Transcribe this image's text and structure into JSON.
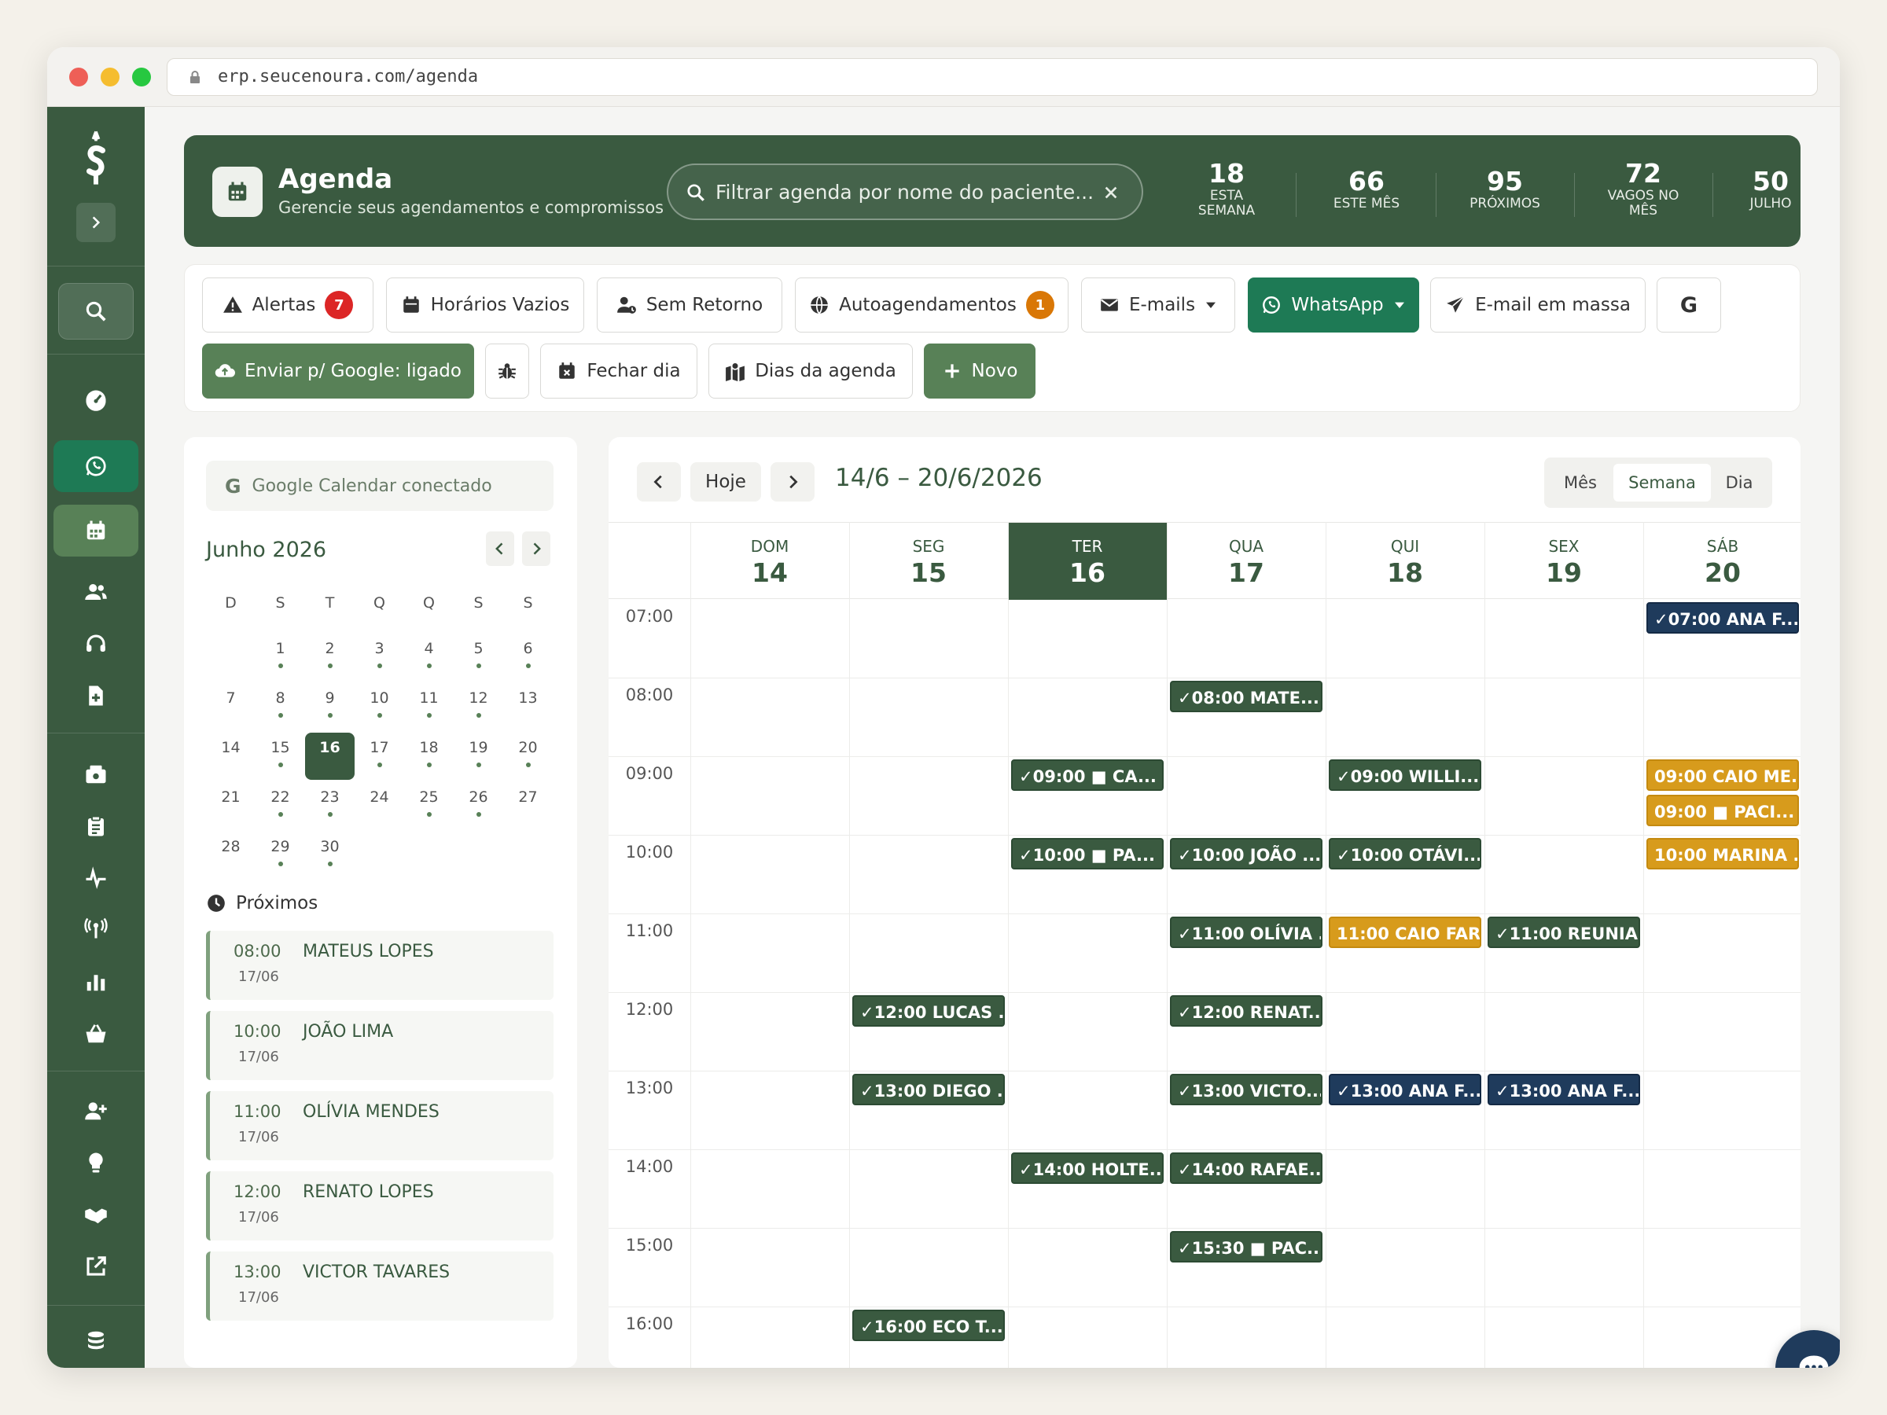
{
  "browser": {
    "url": "erp.seucenoura.com/agenda"
  },
  "colors": {
    "primary": "#3a5a40",
    "accent": "#588157",
    "navy": "#1f3b5c",
    "gold": "#d79b1c",
    "danger": "#dc2626",
    "warning": "#d97706"
  },
  "header": {
    "title": "Agenda",
    "subtitle": "Gerencie seus agendamentos e compromissos",
    "search_placeholder": "Filtrar agenda por nome do paciente...",
    "stats": [
      {
        "value": "18",
        "label1": "ESTA",
        "label2": "SEMANA"
      },
      {
        "value": "66",
        "label1": "ESTE MÊS",
        "label2": ""
      },
      {
        "value": "95",
        "label1": "PRÓXIMOS",
        "label2": ""
      },
      {
        "value": "72",
        "label1": "VAGOS NO",
        "label2": "MÊS"
      },
      {
        "value": "50",
        "label1": "JULHO",
        "label2": ""
      }
    ]
  },
  "toolbar": {
    "alertas": "Alertas",
    "alertas_count": "7",
    "horarios": "Horários Vazios",
    "sem_retorno": "Sem Retorno",
    "autoag": "Autoagendamentos",
    "autoag_count": "1",
    "emails": "E-mails",
    "whatsapp": "WhatsApp",
    "email_massa": "E-mail em massa",
    "google_letter": "G",
    "enviar_google": "Enviar p/ Google: ligado",
    "fechar_dia": "Fechar dia",
    "dias_agenda": "Dias da agenda",
    "novo": "Novo"
  },
  "mini_calendar": {
    "gcal_status": "Google Calendar conectado",
    "month_title": "Junho 2026",
    "weekdays": [
      "D",
      "S",
      "T",
      "Q",
      "Q",
      "S",
      "S"
    ],
    "weeks": [
      [
        {
          "d": "",
          "m": false
        },
        {
          "d": "1",
          "m": true
        },
        {
          "d": "2",
          "m": true
        },
        {
          "d": "3",
          "m": true
        },
        {
          "d": "4",
          "m": true
        },
        {
          "d": "5",
          "m": true
        },
        {
          "d": "6",
          "m": true
        }
      ],
      [
        {
          "d": "7",
          "m": false
        },
        {
          "d": "8",
          "m": true
        },
        {
          "d": "9",
          "m": true
        },
        {
          "d": "10",
          "m": true
        },
        {
          "d": "11",
          "m": true
        },
        {
          "d": "12",
          "m": true
        },
        {
          "d": "13",
          "m": false
        }
      ],
      [
        {
          "d": "14",
          "m": false
        },
        {
          "d": "15",
          "m": true
        },
        {
          "d": "16",
          "m": false,
          "today": true
        },
        {
          "d": "17",
          "m": true
        },
        {
          "d": "18",
          "m": true
        },
        {
          "d": "19",
          "m": true
        },
        {
          "d": "20",
          "m": true
        }
      ],
      [
        {
          "d": "21",
          "m": false
        },
        {
          "d": "22",
          "m": true
        },
        {
          "d": "23",
          "m": true
        },
        {
          "d": "24",
          "m": false
        },
        {
          "d": "25",
          "m": true
        },
        {
          "d": "26",
          "m": true
        },
        {
          "d": "27",
          "m": false
        }
      ],
      [
        {
          "d": "28",
          "m": false
        },
        {
          "d": "29",
          "m": true
        },
        {
          "d": "30",
          "m": true
        }
      ]
    ]
  },
  "proximos": {
    "title": "Próximos",
    "items": [
      {
        "time": "08:00",
        "date": "17/06",
        "name": "MATEUS LOPES"
      },
      {
        "time": "10:00",
        "date": "17/06",
        "name": "JOÃO LIMA"
      },
      {
        "time": "11:00",
        "date": "17/06",
        "name": "OLÍVIA MENDES"
      },
      {
        "time": "12:00",
        "date": "17/06",
        "name": "RENATO LOPES"
      },
      {
        "time": "13:00",
        "date": "17/06",
        "name": "VICTOR TAVARES"
      }
    ]
  },
  "calendar": {
    "today_label": "Hoje",
    "range": "14/6 – 20/6/2026",
    "views": [
      "Mês",
      "Semana",
      "Dia"
    ],
    "active_view": "Semana",
    "days": [
      {
        "name": "DOM",
        "num": "14"
      },
      {
        "name": "SEG",
        "num": "15"
      },
      {
        "name": "TER",
        "num": "16",
        "today": true
      },
      {
        "name": "QUA",
        "num": "17"
      },
      {
        "name": "QUI",
        "num": "18"
      },
      {
        "name": "SEX",
        "num": "19"
      },
      {
        "name": "SÁB",
        "num": "20"
      }
    ],
    "hours": [
      "07:00",
      "08:00",
      "09:00",
      "10:00",
      "11:00",
      "12:00",
      "13:00",
      "14:00",
      "15:00",
      "16:00"
    ],
    "events": [
      {
        "day": 6,
        "slot": 0,
        "sub": 0,
        "color": "navy",
        "label": "✓07:00 ANA F..."
      },
      {
        "day": 3,
        "slot": 1,
        "sub": 0,
        "color": "green",
        "label": "✓08:00 MATE..."
      },
      {
        "day": 2,
        "slot": 2,
        "sub": 0,
        "color": "green",
        "label": "✓09:00 ■ CA..."
      },
      {
        "day": 4,
        "slot": 2,
        "sub": 0,
        "color": "green",
        "label": "✓09:00 WILLI..."
      },
      {
        "day": 6,
        "slot": 2,
        "sub": 0,
        "color": "gold",
        "label": "09:00 CAIO ME..."
      },
      {
        "day": 6,
        "slot": 2,
        "sub": 1,
        "color": "gold",
        "label": "09:00 ■ PACI..."
      },
      {
        "day": 2,
        "slot": 3,
        "sub": 0,
        "color": "green",
        "label": "✓10:00 ■ PA..."
      },
      {
        "day": 3,
        "slot": 3,
        "sub": 0,
        "color": "green",
        "label": "✓10:00 JOÃO ..."
      },
      {
        "day": 4,
        "slot": 3,
        "sub": 0,
        "color": "green",
        "label": "✓10:00 OTÁVI..."
      },
      {
        "day": 6,
        "slot": 3,
        "sub": 0,
        "color": "gold",
        "label": "10:00 MARINA ..."
      },
      {
        "day": 3,
        "slot": 4,
        "sub": 0,
        "color": "green",
        "label": "✓11:00 OLÍVIA ..."
      },
      {
        "day": 4,
        "slot": 4,
        "sub": 0,
        "color": "gold",
        "label": "11:00 CAIO FAR..."
      },
      {
        "day": 5,
        "slot": 4,
        "sub": 0,
        "color": "green",
        "label": "✓11:00 REUNIA..."
      },
      {
        "day": 1,
        "slot": 5,
        "sub": 0,
        "color": "green",
        "label": "✓12:00 LUCAS ..."
      },
      {
        "day": 3,
        "slot": 5,
        "sub": 0,
        "color": "green",
        "label": "✓12:00 RENAT..."
      },
      {
        "day": 1,
        "slot": 6,
        "sub": 0,
        "color": "green",
        "label": "✓13:00 DIEGO ..."
      },
      {
        "day": 3,
        "slot": 6,
        "sub": 0,
        "color": "green",
        "label": "✓13:00 VICTO..."
      },
      {
        "day": 4,
        "slot": 6,
        "sub": 0,
        "color": "navy",
        "label": "✓13:00 ANA F..."
      },
      {
        "day": 5,
        "slot": 6,
        "sub": 0,
        "color": "navy",
        "label": "✓13:00 ANA F..."
      },
      {
        "day": 2,
        "slot": 7,
        "sub": 0,
        "color": "green",
        "label": "✓14:00 HOLTE..."
      },
      {
        "day": 3,
        "slot": 7,
        "sub": 0,
        "color": "green",
        "label": "✓14:00 RAFAE..."
      },
      {
        "day": 3,
        "slot": 8,
        "sub": 0,
        "color": "green",
        "label": "✓15:30 ■ PAC..."
      },
      {
        "day": 1,
        "slot": 9,
        "sub": 0,
        "color": "green",
        "label": "✓16:00 ECO T..."
      }
    ]
  },
  "sidebar_icons": [
    "logo-icon",
    "expand-icon",
    "search-icon",
    "dashboard-icon",
    "whatsapp-icon",
    "calendar-icon",
    "users-icon",
    "headset-icon",
    "document-icon",
    "cashbox-icon",
    "clipboard-icon",
    "pulse-icon",
    "antenna-icon",
    "chart-icon",
    "basket-icon",
    "user-plus-icon",
    "lightbulb-icon",
    "handshake-icon",
    "external-link-icon",
    "coins-icon"
  ]
}
